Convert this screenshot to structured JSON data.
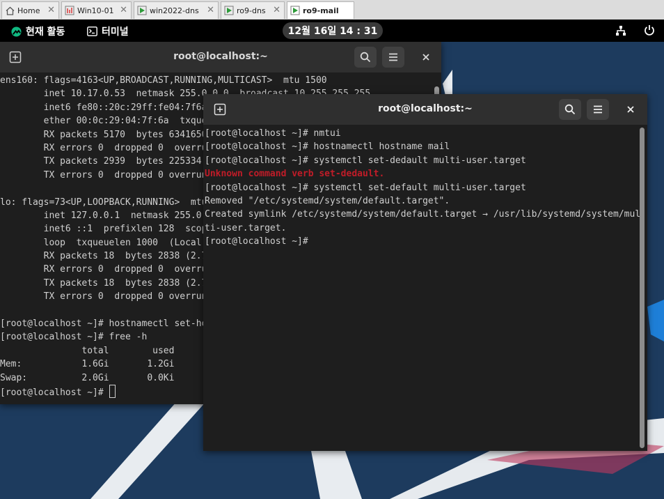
{
  "tabs": [
    {
      "label": "Home",
      "icon": "home-icon"
    },
    {
      "label": "Win10-01",
      "icon": "vm-icon"
    },
    {
      "label": "win2022-dns",
      "icon": "vm-running-icon"
    },
    {
      "label": "ro9-dns",
      "icon": "vm-running-icon"
    },
    {
      "label": "ro9-mail",
      "icon": "vm-running-icon",
      "active": true
    }
  ],
  "topbar": {
    "activities": "현재 활동",
    "app_name": "터미널",
    "clock": "12월 16일 14 : 31"
  },
  "back_terminal": {
    "title": "root@localhost:~",
    "lines": [
      "ens160: flags=4163<UP,BROADCAST,RUNNING,MULTICAST>  mtu 1500",
      "        inet 10.17.0.53  netmask 255.0.0.0  broadcast 10.255.255.255",
      "        inet6 fe80::20c:29ff:fe04:7f6a",
      "        ether 00:0c:29:04:7f:6a  txque",
      "        RX packets 5170  bytes 6341650",
      "        RX errors 0  dropped 0  overru",
      "        TX packets 2939  bytes 225334",
      "        TX errors 0  dropped 0 overrun",
      "",
      "lo: flags=73<UP,LOOPBACK,RUNNING>  mtu",
      "        inet 127.0.0.1  netmask 255.0.",
      "        inet6 ::1  prefixlen 128  scop",
      "        loop  txqueuelen 1000  (Local",
      "        RX packets 18  bytes 2838 (2.7",
      "        RX errors 0  dropped 0  overru",
      "        TX packets 18  bytes 2838 (2.7",
      "        TX errors 0  dropped 0 overrun",
      "",
      "[root@localhost ~]# hostnamectl set-ho",
      "[root@localhost ~]# free -h",
      "               total        used",
      "Mem:           1.6Gi       1.2Gi",
      "Swap:          2.0Gi       0.0Ki"
    ],
    "prompt": "[root@localhost ~]# "
  },
  "front_terminal": {
    "title": "root@localhost:~",
    "lines": [
      {
        "text": "[root@localhost ~]# nmtui"
      },
      {
        "text": "[root@localhost ~]# hostnamectl hostname mail"
      },
      {
        "text": "[root@localhost ~]# systemctl set-dedault multi-user.target"
      },
      {
        "text": "Unknown command verb set-dedault.",
        "error": true
      },
      {
        "text": "[root@localhost ~]# systemctl set-default multi-user.target"
      },
      {
        "text": "Removed \"/etc/systemd/system/default.target\"."
      },
      {
        "text": "Created symlink /etc/systemd/system/default.target → /usr/lib/systemd/system/mul"
      },
      {
        "text": "ti-user.target."
      },
      {
        "text": "[root@localhost ~]# "
      }
    ]
  },
  "colors": {
    "desktop_bg": "#1d3b5e",
    "terminal_bg": "#1e1e1e",
    "header_bg": "#2f2f2f",
    "error_text": "#c01c28"
  }
}
